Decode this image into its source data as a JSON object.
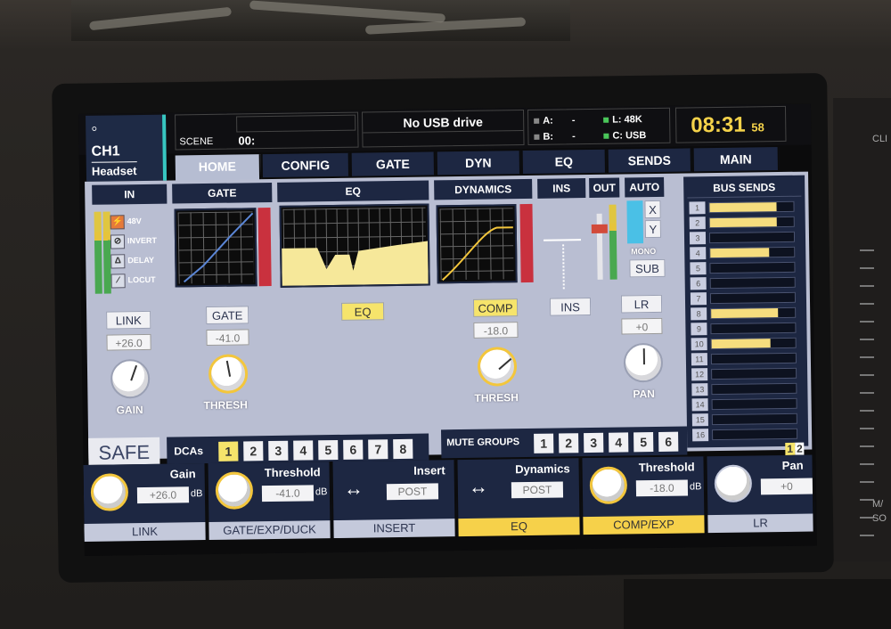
{
  "header": {
    "channel_id": "CH1",
    "channel_name": "Headset",
    "scene_label": "SCENE",
    "scene_value": "00:",
    "usb_status": "No USB drive",
    "slot_a_label": "A:",
    "slot_a_value": "-",
    "slot_b_label": "B:",
    "slot_b_value": "-",
    "slot_l_label": "L:",
    "slot_l_value": "48K",
    "slot_c_label": "C:",
    "slot_c_value": "USB",
    "clock_time": "08:31",
    "clock_seconds": "58"
  },
  "tabs": [
    "HOME",
    "CONFIG",
    "GATE",
    "DYN",
    "EQ",
    "SENDS",
    "MAIN"
  ],
  "sections": {
    "in": "IN",
    "gate": "GATE",
    "eq": "EQ",
    "dynamics": "DYNAMICS",
    "ins": "INS",
    "out": "OUT",
    "auto": "AUTO",
    "bus_sends": "BUS SENDS"
  },
  "in_options": [
    "48V",
    "INVERT",
    "DELAY",
    "LOCUT"
  ],
  "auto": {
    "x": "X",
    "y": "Y",
    "mono": "MONO",
    "sub": "SUB"
  },
  "buttons": {
    "link": "LINK",
    "gate": "GATE",
    "eq": "EQ",
    "comp": "COMP",
    "ins": "INS",
    "lr": "LR"
  },
  "values": {
    "gain": "+26.0",
    "gate_thresh": "-41.0",
    "comp_thresh": "-18.0",
    "pan": "+0"
  },
  "knob_labels": {
    "gain": "GAIN",
    "gate_thresh": "THRESH",
    "comp_thresh": "THRESH",
    "pan": "PAN"
  },
  "safe": "SAFE",
  "dcas": {
    "label": "DCAs",
    "numbers": [
      "1",
      "2",
      "3",
      "4",
      "5",
      "6",
      "7",
      "8"
    ],
    "active": [
      "1"
    ]
  },
  "mute_groups": {
    "label": "MUTE GROUPS",
    "numbers": [
      "1",
      "2",
      "3",
      "4",
      "5",
      "6"
    ]
  },
  "bus_sends": {
    "numbers": [
      "1",
      "2",
      "3",
      "4",
      "5",
      "6",
      "7",
      "8",
      "9",
      "10",
      "11",
      "12",
      "13",
      "14",
      "15",
      "16"
    ],
    "levels": [
      0.8,
      0.8,
      0,
      0.7,
      0,
      0,
      0,
      0.8,
      0,
      0.7,
      0,
      0,
      0,
      0,
      0,
      0
    ],
    "pages": [
      "1",
      "2"
    ]
  },
  "strip": [
    {
      "title": "Gain",
      "value": "+26.0",
      "unit": "dB",
      "footer": "LINK"
    },
    {
      "title": "Threshold",
      "value": "-41.0",
      "unit": "dB",
      "footer": "GATE/EXP/DUCK"
    },
    {
      "title": "Insert",
      "value": "POST",
      "unit": "",
      "footer": "INSERT"
    },
    {
      "title": "Dynamics",
      "value": "POST",
      "unit": "",
      "footer": "EQ"
    },
    {
      "title": "Threshold",
      "value": "-18.0",
      "unit": "dB",
      "footer": "COMP/EXP"
    },
    {
      "title": "Pan",
      "value": "+0",
      "unit": "",
      "footer": "LR"
    }
  ],
  "device_labels": {
    "top_right": "CLI",
    "bottom_right": "M/",
    "bottom_right_2": "SO"
  },
  "colors": {
    "accent_yellow": "#f6e46b",
    "panel_navy": "#1d2742",
    "meter_red": "#c9313e",
    "clock": "#f4d24a"
  }
}
